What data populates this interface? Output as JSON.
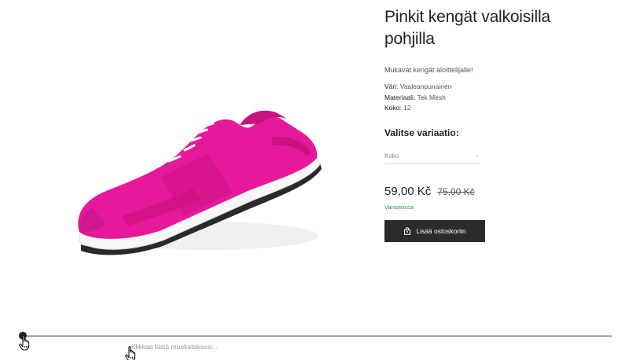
{
  "product": {
    "title": "Pinkit kengät valkoisilla pohjilla",
    "short_description": "Mukavat kengät aloittelijalle!",
    "attributes": [
      {
        "key": "Väri",
        "value": "Vaaleanpunainen"
      },
      {
        "key": "Materiaali",
        "value": "Tek Mesh"
      },
      {
        "key": "Koko",
        "value": "12"
      }
    ],
    "variation_label": "Valitse variaatio:",
    "variation_select": {
      "selected": "Koko"
    },
    "price": "59,00 Kč",
    "price_old": "75,00 Kč",
    "stock": "Varastossa",
    "add_to_cart_label": "Lisää ostoskoriin"
  },
  "editor": {
    "edit_hint": "Klikkaa tästä muokataksesi..."
  },
  "colors": {
    "shoe": "#e6189b",
    "sole": "#ffffff",
    "button": "#2b2b2b",
    "stock": "#2e9b3a"
  },
  "icons": [
    "shopping-bag-icon",
    "chevron-down-icon",
    "hand-pointer-icon"
  ]
}
